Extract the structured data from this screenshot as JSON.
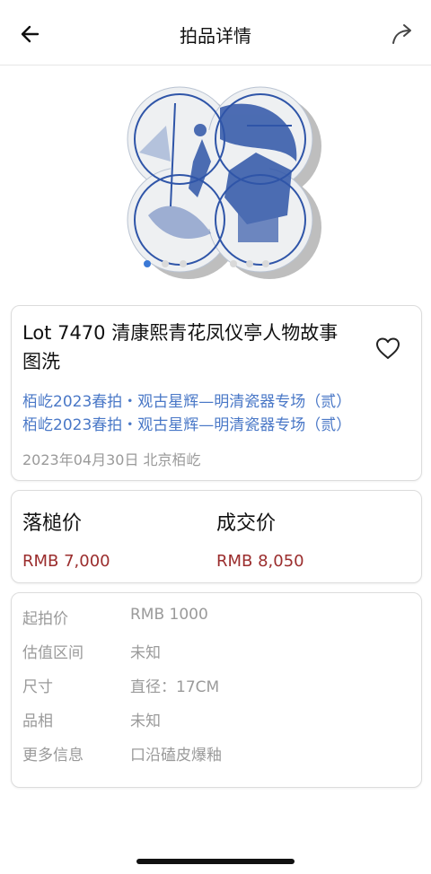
{
  "nav": {
    "title": "拍品详情",
    "back_icon": "arrow-left-icon",
    "share_icon": "share-arrow-icon"
  },
  "gallery": {
    "image_alt": "青花凤仪亭人物故事图洗",
    "image_count": 6,
    "active_index": 0
  },
  "lot": {
    "title": "Lot 7470 清康熙青花凤仪亭人物故事图洗",
    "sale_link_1": "栢屹2023春拍・观古星辉—明清瓷器专场（贰）",
    "sale_link_2": "栢屹2023春拍・观古星辉—明清瓷器专场（贰）",
    "date_location": "2023年04月30日 北京栢屹",
    "favorite_icon": "heart-outline-icon"
  },
  "prices": {
    "hammer_label": "落槌价",
    "hammer_value": "RMB 7,000",
    "deal_label": "成交价",
    "deal_value": "RMB 8,050"
  },
  "details": [
    {
      "label": "起拍价",
      "value": "RMB 1000"
    },
    {
      "label": "估值区间",
      "value": "未知"
    },
    {
      "label": "尺寸",
      "value": "直径：17CM"
    },
    {
      "label": "品相",
      "value": "未知"
    },
    {
      "label": "更多信息",
      "value": "口沿磕皮爆釉"
    }
  ],
  "colors": {
    "link": "#4a78c7",
    "price": "#9b2d2d",
    "accent_dot": "#3b79d6"
  }
}
